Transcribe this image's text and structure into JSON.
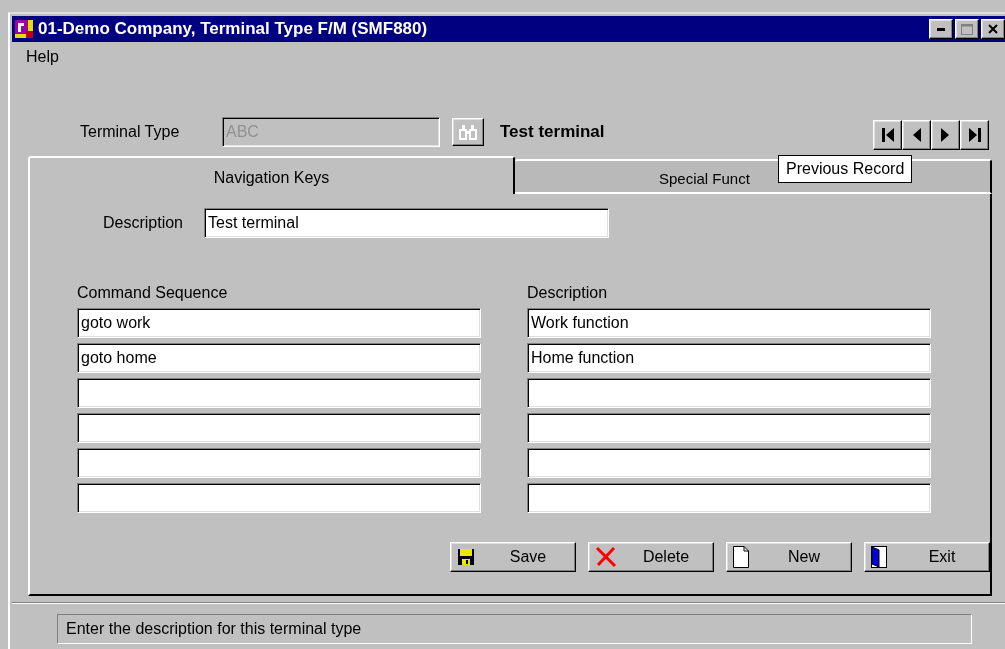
{
  "window": {
    "title": "01-Demo Company, Terminal Type F/M (SMF880)"
  },
  "menu": [
    {
      "label": "Help"
    }
  ],
  "header": {
    "label": "Terminal Type",
    "field": {
      "value": "ABC",
      "disabled": true
    },
    "name": "Test terminal"
  },
  "record_nav": {
    "tooltip": "Previous Record"
  },
  "tabs": [
    {
      "label": "Navigation Keys",
      "selected": true
    },
    {
      "label": "Special Funct",
      "selected": false
    }
  ],
  "description": {
    "label": "Description",
    "value": "Test terminal"
  },
  "columns": [
    "Command Sequence",
    "Description"
  ],
  "rows": [
    {
      "command": "goto work",
      "description": "Work function"
    },
    {
      "command": "goto home",
      "description": "Home function"
    },
    {},
    {},
    {},
    {}
  ],
  "buttons": [
    {
      "label": "Save",
      "kind": "save"
    },
    {
      "label": "Delete",
      "kind": "delete"
    },
    {
      "label": "New",
      "kind": "new"
    },
    {
      "label": "Exit",
      "kind": "exit"
    }
  ],
  "status_bar": {
    "text": "Enter the description for this terminal type"
  }
}
